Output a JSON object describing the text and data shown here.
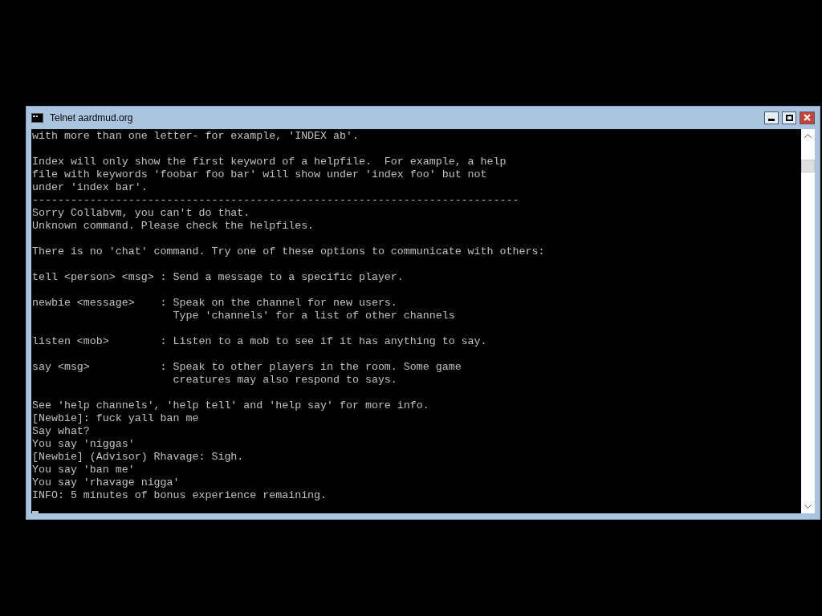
{
  "window": {
    "title": "Telnet aardmud.org"
  },
  "console": {
    "blocks": [
      [
        "with more than one letter- for example, 'INDEX ab'."
      ],
      [
        "Index will only show the first keyword of a helpfile.  For example, a help",
        "file with keywords 'foobar foo bar' will show under 'index foo' but not",
        "under 'index bar'.",
        "----------------------------------------------------------------------------",
        "Sorry Collabvm, you can't do that.",
        "Unknown command. Please check the helpfiles."
      ],
      [
        "There is no 'chat' command. Try one of these options to communicate with others:"
      ],
      [
        "tell <person> <msg> : Send a message to a specific player."
      ],
      [
        "newbie <message>    : Speak on the channel for new users.",
        "                      Type 'channels' for a list of other channels"
      ],
      [
        "listen <mob>        : Listen to a mob to see if it has anything to say."
      ],
      [
        "say <msg>           : Speak to other players in the room. Some game",
        "                      creatures may also respond to says."
      ],
      [
        "See 'help channels', 'help tell' and 'help say' for more info.",
        "[Newbie]: fuck yall ban me",
        "Say what?",
        "You say 'niggas'",
        "[Newbie] (Advisor) Rhavage: Sigh.",
        "You say 'ban me'",
        "You say 'rhavage nigga'",
        "INFO: 5 minutes of bonus experience remaining."
      ]
    ],
    "cursor": true
  }
}
